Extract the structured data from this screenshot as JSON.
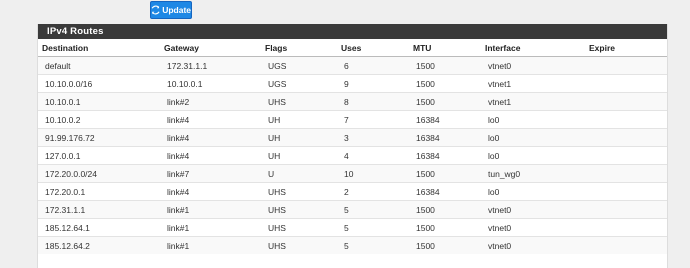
{
  "toolbar": {
    "update_label": "Update"
  },
  "panel": {
    "title": "IPv4 Routes"
  },
  "table": {
    "headers": [
      "Destination",
      "Gateway",
      "Flags",
      "Uses",
      "MTU",
      "Interface",
      "Expire"
    ],
    "rows": [
      [
        "default",
        "172.31.1.1",
        "UGS",
        "6",
        "1500",
        "vtnet0",
        ""
      ],
      [
        "10.10.0.0/16",
        "10.10.0.1",
        "UGS",
        "9",
        "1500",
        "vtnet1",
        ""
      ],
      [
        "10.10.0.1",
        "link#2",
        "UHS",
        "8",
        "1500",
        "vtnet1",
        ""
      ],
      [
        "10.10.0.2",
        "link#4",
        "UH",
        "7",
        "16384",
        "lo0",
        ""
      ],
      [
        "91.99.176.72",
        "link#4",
        "UH",
        "3",
        "16384",
        "lo0",
        ""
      ],
      [
        "127.0.0.1",
        "link#4",
        "UH",
        "4",
        "16384",
        "lo0",
        ""
      ],
      [
        "172.20.0.0/24",
        "link#7",
        "U",
        "10",
        "1500",
        "tun_wg0",
        ""
      ],
      [
        "172.20.0.1",
        "link#4",
        "UHS",
        "2",
        "16384",
        "lo0",
        ""
      ],
      [
        "172.31.1.1",
        "link#1",
        "UHS",
        "5",
        "1500",
        "vtnet0",
        ""
      ],
      [
        "185.12.64.1",
        "link#1",
        "UHS",
        "5",
        "1500",
        "vtnet0",
        ""
      ],
      [
        "185.12.64.2",
        "link#1",
        "UHS",
        "5",
        "1500",
        "vtnet0",
        ""
      ]
    ]
  }
}
